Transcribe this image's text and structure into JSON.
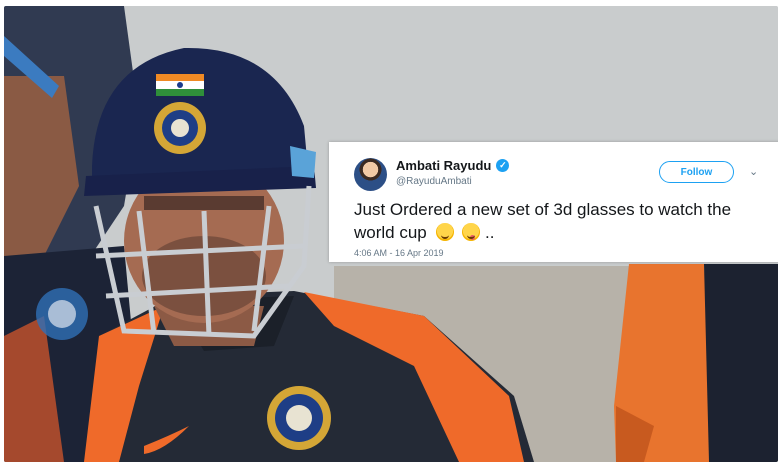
{
  "photo": {
    "description_icons": [
      "india-flag-icon",
      "bcci-crest-icon",
      "nike-swoosh-icon"
    ]
  },
  "tweet": {
    "author_name": "Ambati Rayudu",
    "handle": "@RayuduAmbati",
    "follow_label": "Follow",
    "text": "Just Ordered a new set of 3d glasses to watch the world cup",
    "text_suffix": "..",
    "timestamp": "4:06 AM - 16 Apr 2019",
    "colors": {
      "accent": "#1da1f2",
      "name": "#14171a",
      "muted": "#657786"
    }
  }
}
